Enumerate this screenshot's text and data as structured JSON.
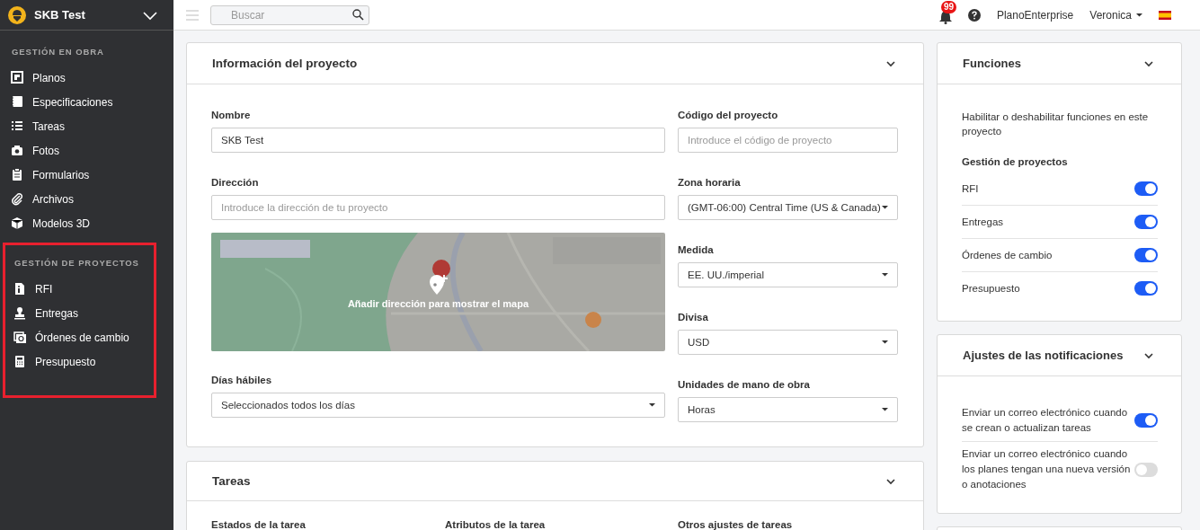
{
  "sidebar": {
    "project": "SKB Test",
    "sections": [
      {
        "title": "GESTIÓN EN OBRA",
        "highlighted": false,
        "items": [
          {
            "label": "Planos"
          },
          {
            "label": "Especificaciones"
          },
          {
            "label": "Tareas"
          },
          {
            "label": "Fotos"
          },
          {
            "label": "Formularios"
          },
          {
            "label": "Archivos"
          },
          {
            "label": "Modelos 3D"
          }
        ]
      },
      {
        "title": "GESTIÓN DE PROYECTOS",
        "highlighted": true,
        "items": [
          {
            "label": "RFI"
          },
          {
            "label": "Entregas"
          },
          {
            "label": "Órdenes de cambio"
          },
          {
            "label": "Presupuesto"
          }
        ]
      }
    ]
  },
  "topbar": {
    "search": {
      "placeholder": "Buscar"
    },
    "notifications": "99",
    "organization": "PlanoEnterprise",
    "user": "Veronica"
  },
  "project_info": {
    "title": "Información del proyecto",
    "left": [
      {
        "kind": "input",
        "label": "Nombre",
        "value": "SKB Test"
      },
      {
        "kind": "input",
        "label": "Dirección",
        "placeholder": "Introduce la dirección de tu proyecto"
      },
      {
        "kind": "map",
        "overlay": "Añadir dirección para mostrar el mapa"
      },
      {
        "kind": "select",
        "label": "Días hábiles",
        "value": "Seleccionados todos los días"
      }
    ],
    "right": [
      {
        "kind": "input",
        "label": "Código del proyecto",
        "placeholder": "Introduce el código de proyecto"
      },
      {
        "kind": "select",
        "label": "Zona horaria",
        "value": "(GMT-06:00) Central Time (US & Canada)"
      },
      {
        "kind": "select",
        "label": "Medida",
        "value": "EE. UU./imperial"
      },
      {
        "kind": "select",
        "label": "Divisa",
        "value": "USD"
      },
      {
        "kind": "select",
        "label": "Unidades de mano de obra",
        "value": "Horas"
      }
    ]
  },
  "tasks": {
    "title": "Tareas",
    "columns": [
      "Estados de la tarea",
      "Atributos de la tarea",
      "Otros ajustes de tareas"
    ]
  },
  "functions": {
    "title": "Funciones",
    "description": "Habilitar o deshabilitar funciones en este proyecto",
    "group": "Gestión de proyectos",
    "rows": [
      {
        "label": "RFI",
        "on": true
      },
      {
        "label": "Entregas",
        "on": true
      },
      {
        "label": "Órdenes de cambio",
        "on": true
      },
      {
        "label": "Presupuesto",
        "on": true
      }
    ]
  },
  "notifications": {
    "title": "Ajustes de las notificaciones",
    "rows": [
      {
        "label": "Enviar un correo electrónico cuando se crean o actualizan tareas",
        "on": true
      },
      {
        "label": "Enviar un correo electrónico cuando los planes tengan una nueva versión o anotaciones",
        "on": false
      }
    ]
  }
}
